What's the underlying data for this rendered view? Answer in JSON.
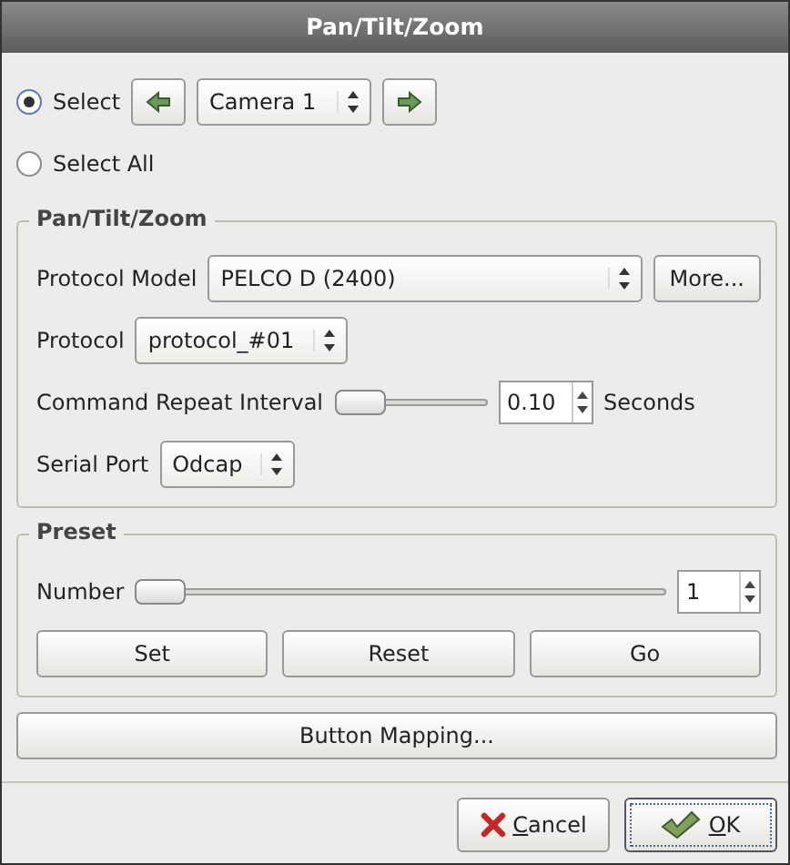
{
  "window": {
    "title": "Pan/Tilt/Zoom"
  },
  "selection": [
    {
      "label": "Select",
      "selected": true
    },
    {
      "label": "Select All",
      "selected": false
    }
  ],
  "camera": {
    "value": "Camera 1"
  },
  "ptz": {
    "title": "Pan/Tilt/Zoom",
    "protocol_model_label": "Protocol Model",
    "protocol_model": "PELCO D (2400)",
    "more_button": "More...",
    "protocol_label": "Protocol",
    "protocol": "protocol_#01",
    "interval_label": "Command Repeat Interval",
    "interval": {
      "level": 0
    },
    "interval_value": "0.10",
    "interval_unit": "Seconds",
    "serial_label": "Serial Port",
    "serial": "Odcap"
  },
  "preset": {
    "title": "Preset",
    "number_label": "Number",
    "number": {
      "level": 0
    },
    "number_value": "1",
    "buttons": [
      "Set",
      "Reset",
      "Go"
    ]
  },
  "mapping_button": "Button Mapping...",
  "dialog_buttons": [
    {
      "kind": "cancel",
      "label": "Cancel",
      "default": false
    },
    {
      "kind": "ok",
      "label": "OK",
      "default": true
    }
  ]
}
